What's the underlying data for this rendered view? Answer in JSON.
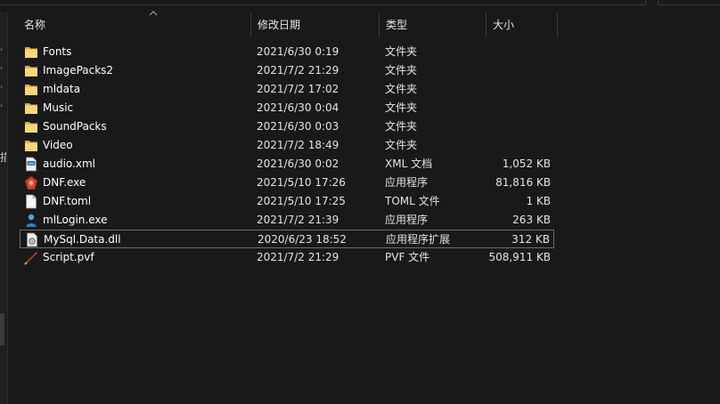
{
  "header": {
    "name": "名称",
    "date": "修改日期",
    "type": "类型",
    "size": "大小"
  },
  "files": [
    {
      "name": "Fonts",
      "date": "2021/6/30 0:19",
      "type": "文件夹",
      "size": "",
      "icon": "folder-icon"
    },
    {
      "name": "ImagePacks2",
      "date": "2021/7/2 21:29",
      "type": "文件夹",
      "size": "",
      "icon": "folder-icon"
    },
    {
      "name": "mldata",
      "date": "2021/7/2 17:02",
      "type": "文件夹",
      "size": "",
      "icon": "folder-icon"
    },
    {
      "name": "Music",
      "date": "2021/6/30 0:04",
      "type": "文件夹",
      "size": "",
      "icon": "folder-icon"
    },
    {
      "name": "SoundPacks",
      "date": "2021/6/30 0:03",
      "type": "文件夹",
      "size": "",
      "icon": "folder-icon"
    },
    {
      "name": "Video",
      "date": "2021/7/2 18:49",
      "type": "文件夹",
      "size": "",
      "icon": "folder-icon"
    },
    {
      "name": "audio.xml",
      "date": "2021/6/30 0:02",
      "type": "XML 文档",
      "size": "1,052 KB",
      "icon": "xml-file-icon"
    },
    {
      "name": "DNF.exe",
      "date": "2021/5/10 17:26",
      "type": "应用程序",
      "size": "81,816 KB",
      "icon": "dnf-app-icon"
    },
    {
      "name": "DNF.toml",
      "date": "2021/5/10 17:25",
      "type": "TOML 文件",
      "size": "1 KB",
      "icon": "blank-file-icon"
    },
    {
      "name": "mlLogin.exe",
      "date": "2021/7/2 21:39",
      "type": "应用程序",
      "size": "263 KB",
      "icon": "user-app-icon"
    },
    {
      "name": "MySql.Data.dll",
      "date": "2020/6/23 18:52",
      "type": "应用程序扩展",
      "size": "312 KB",
      "icon": "dll-file-icon",
      "selected": true
    },
    {
      "name": "Script.pvf",
      "date": "2021/7/2 21:29",
      "type": "PVF 文件",
      "size": "508,911 KB",
      "icon": "pvf-file-icon"
    }
  ],
  "nav": {
    "glyph": "描"
  },
  "colors": {
    "background": "#191919",
    "text": "#ffffff",
    "folder": "#f8d775",
    "selection_border": "#6d6d6d"
  }
}
